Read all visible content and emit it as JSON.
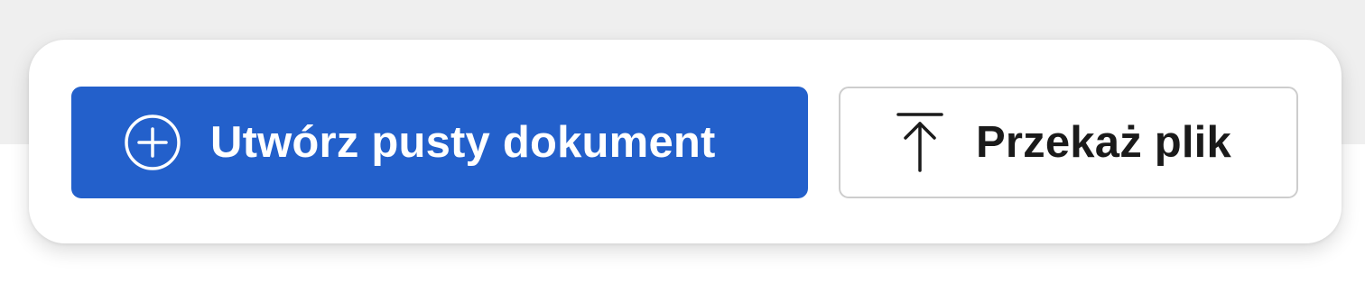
{
  "actions": {
    "create_blank": {
      "label": "Utwórz pusty dokument",
      "icon": "plus-circle-icon",
      "background_color": "#2360cb",
      "text_color": "#ffffff"
    },
    "upload_file": {
      "label": "Przekaż plik",
      "icon": "upload-icon",
      "background_color": "#ffffff",
      "text_color": "#1a1a1a"
    }
  }
}
